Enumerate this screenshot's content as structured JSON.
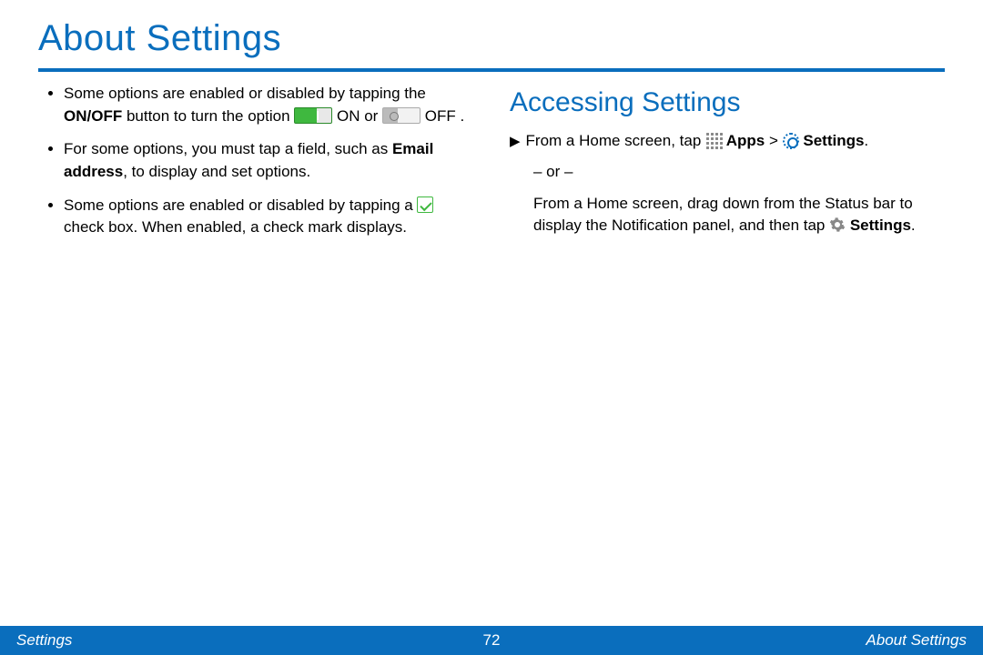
{
  "title": "About Settings",
  "left": {
    "b1": {
      "pre": "Some options are enabled or disabled by tapping the ",
      "onoff": "ON/OFF",
      "mid1": " button to turn the option ",
      "on": " ON or ",
      "off": " OFF ."
    },
    "b2": {
      "pre": "For some options, you must tap a field, such as ",
      "email": "Email address",
      "post": ", to display and set options."
    },
    "b3": {
      "pre": "Some options are enabled or disabled by tapping a ",
      "post": " check box. When enabled, a  check mark displays."
    }
  },
  "right": {
    "heading": "Accessing Settings",
    "step1_pre": "From a Home screen, tap ",
    "apps": "Apps",
    "gt": " > ",
    "settings": "Settings",
    "period": ".",
    "or": "– or –",
    "step2": "From a Home screen, drag down from the Status bar to display the Notification panel, and then tap ",
    "settings2": "Settings"
  },
  "footer": {
    "left": "Settings",
    "page": "72",
    "right": "About Settings"
  }
}
